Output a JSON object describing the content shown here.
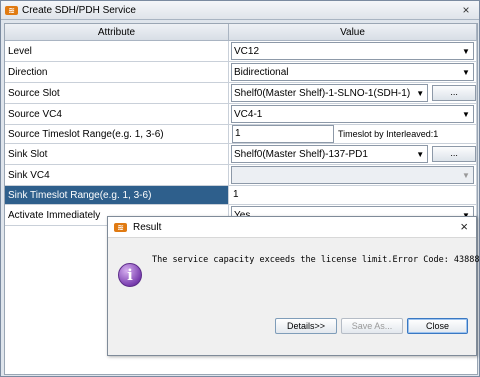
{
  "window": {
    "title": "Create SDH/PDH Service",
    "close_glyph": "×"
  },
  "grid": {
    "headers": {
      "attribute": "Attribute",
      "value": "Value"
    },
    "level": {
      "label": "Level",
      "value": "VC12"
    },
    "direction": {
      "label": "Direction",
      "value": "Bidirectional"
    },
    "source_slot": {
      "label": "Source Slot",
      "value": "Shelf0(Master Shelf)-1-SLNO-1(SDH-1)",
      "button": "..."
    },
    "source_vc4": {
      "label": "Source VC4",
      "value": "VC4-1"
    },
    "source_ts": {
      "label": "Source Timeslot Range(e.g. 1, 3-6)",
      "value": "1",
      "note": "Timeslot by Interleaved:1"
    },
    "sink_slot": {
      "label": "Sink Slot",
      "value": "Shelf0(Master Shelf)-137-PD1",
      "button": "..."
    },
    "sink_vc4": {
      "label": "Sink VC4",
      "value": ""
    },
    "sink_ts": {
      "label": "Sink Timeslot Range(e.g. 1, 3-6)",
      "value": "1"
    },
    "activate": {
      "label": "Activate Immediately",
      "value": "Yes"
    }
  },
  "dialog": {
    "title": "Result",
    "close_glyph": "×",
    "icon_glyph": "i",
    "message": "The service capacity exceeds the license limit.Error Code: 43888",
    "details_button": "Details>>",
    "save_button": "Save As...",
    "close_button": "Close"
  },
  "icons": {
    "app": "app-logo-icon",
    "info": "info-icon",
    "dropdown": "chevron-down-icon"
  },
  "colors": {
    "selected_row": "#2e5f8c",
    "info_icon": "#7b3fb0",
    "app_icon": "#e07a12"
  }
}
